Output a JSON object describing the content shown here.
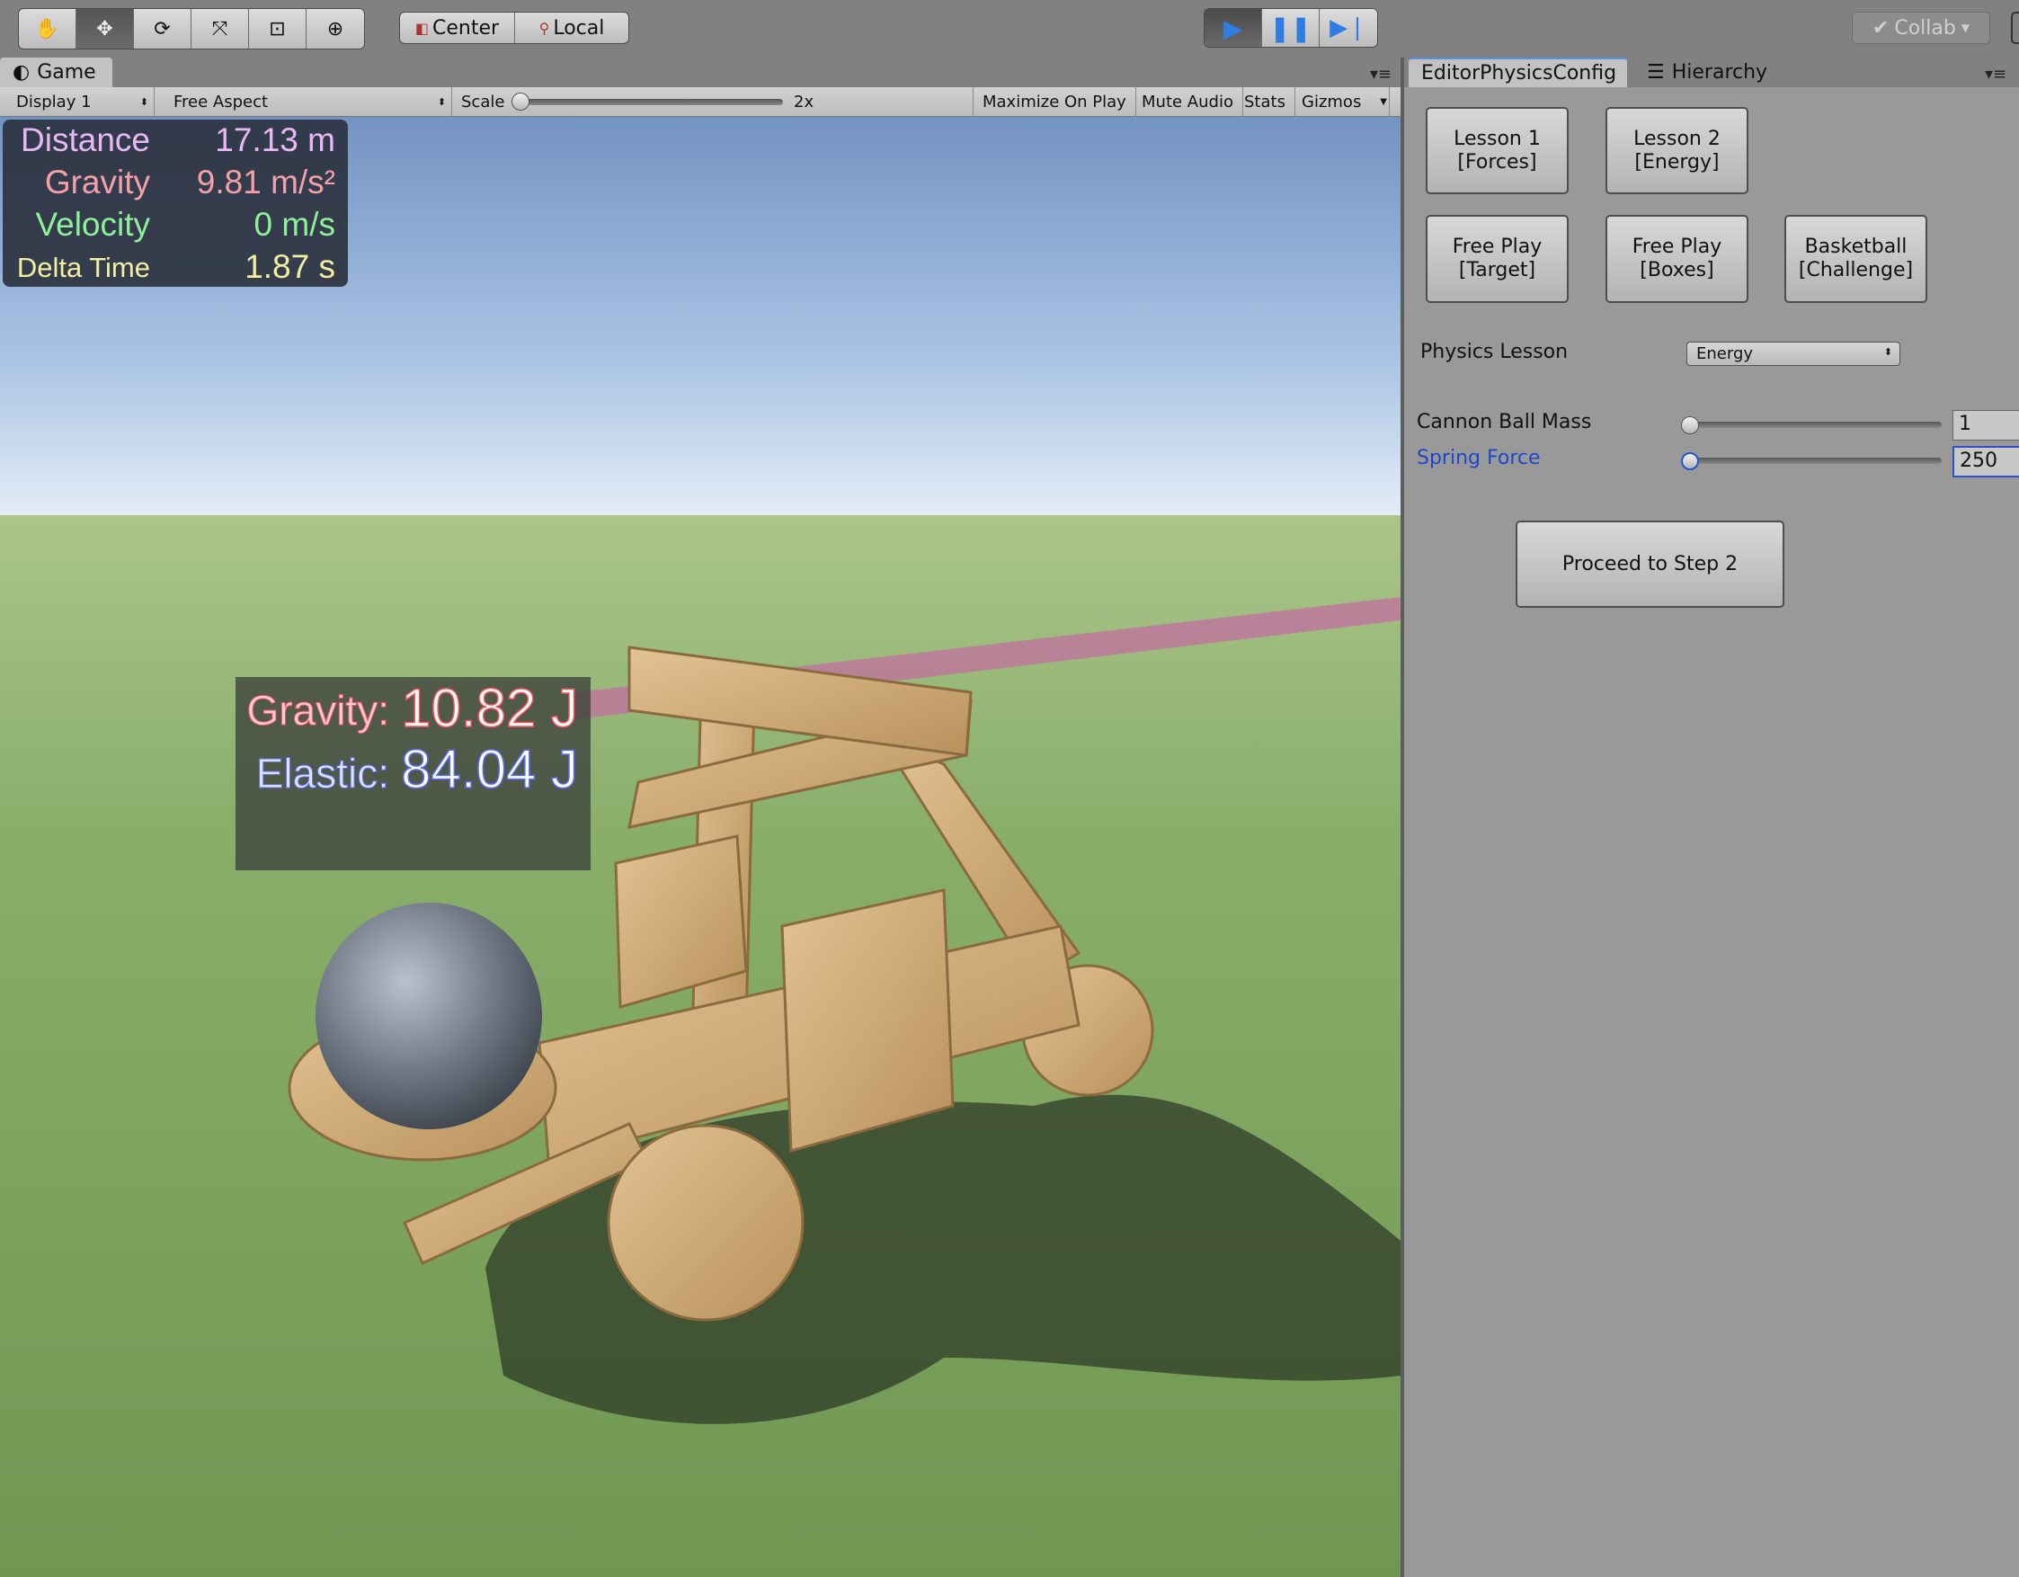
{
  "toolbar": {
    "tools": [
      "hand-tool",
      "move-tool",
      "rotate-tool",
      "scale-tool",
      "rect-tool",
      "transform-tool"
    ],
    "active_tool": "move-tool",
    "pivot_mode": "Center",
    "pivot_rotation": "Local",
    "collab": "Collab",
    "play_state": "playing",
    "accent": "#2f7de1"
  },
  "game": {
    "tab": "Game",
    "display": "Display 1",
    "aspect": "Free Aspect",
    "scale_label": "Scale",
    "scale_value": "2x",
    "maximize": "Maximize On Play",
    "mute": "Mute Audio",
    "stats": "Stats",
    "gizmos": "Gizmos",
    "hud": [
      {
        "label": "Distance",
        "value": "17.13 m",
        "color": "#e8b8f4"
      },
      {
        "label": "Gravity",
        "value": "9.81 m/s²",
        "color": "#f4a0a8"
      },
      {
        "label": "Velocity",
        "value": "0 m/s",
        "color": "#8ff09a"
      },
      {
        "label": "Delta Time",
        "value": "1.87 s",
        "color": "#f2f0a0"
      }
    ],
    "energy": {
      "gravity_label": "Gravity:",
      "gravity_value": "10.82 J",
      "gravity_color": "#ff5060",
      "elastic_label": "Elastic:",
      "elastic_value": "84.04 J",
      "elastic_color": "#5a6cff"
    }
  },
  "panel": {
    "tabs": [
      "EditorPhysicsConfig",
      "Hierarchy"
    ],
    "buttons": [
      "Lesson 1\n[Forces]",
      "Lesson 2\n[Energy]",
      "Free Play\n[Target]",
      "Free Play\n[Boxes]",
      "Basketball\n[Challenge]"
    ],
    "physics_lesson_label": "Physics Lesson",
    "physics_lesson_value": "Energy",
    "mass_label": "Cannon Ball Mass",
    "mass_value": "1",
    "spring_label": "Spring Force",
    "spring_value": "250",
    "proceed": "Proceed to Step 2"
  }
}
